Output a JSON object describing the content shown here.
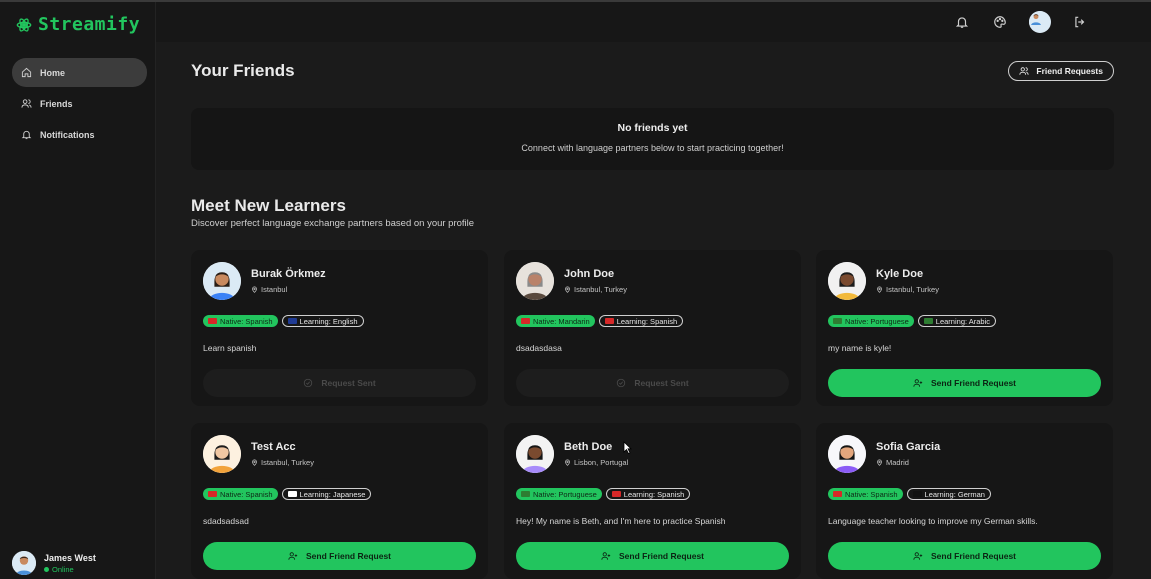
{
  "app": {
    "name": "Streamify"
  },
  "sidebar": {
    "items": [
      {
        "label": "Home",
        "icon": "home-icon",
        "active": true
      },
      {
        "label": "Friends",
        "icon": "users-icon",
        "active": false
      },
      {
        "label": "Notifications",
        "icon": "bell-icon",
        "active": false
      }
    ],
    "user": {
      "name": "James West",
      "status": "Online"
    }
  },
  "topbar": {
    "icons": [
      "bell-icon",
      "palette-icon",
      "avatar",
      "logout-icon"
    ]
  },
  "friends": {
    "title": "Your Friends",
    "requests_button": "Friend Requests",
    "empty_title": "No friends yet",
    "empty_subtitle": "Connect with language partners below to start practicing together!"
  },
  "learners": {
    "title": "Meet New Learners",
    "subtitle": "Discover perfect language exchange partners based on your profile",
    "cards": [
      {
        "name": "Burak Örkmez",
        "location": "Istanbul",
        "native": "Native: Spanish",
        "learning": "Learning: English",
        "bio": "Learn spanish",
        "button": "Request Sent",
        "sent": true
      },
      {
        "name": "John Doe",
        "location": "Istanbul, Turkey",
        "native": "Native: Mandarin",
        "learning": "Learning: Spanish",
        "bio": "dsadasdasa",
        "button": "Request Sent",
        "sent": true
      },
      {
        "name": "Kyle Doe",
        "location": "Istanbul, Turkey",
        "native": "Native: Portuguese",
        "learning": "Learning: Arabic",
        "bio": "my name is kyle!",
        "button": "Send Friend Request",
        "sent": false
      },
      {
        "name": "Test Acc",
        "location": "Istanbul, Turkey",
        "native": "Native: Spanish",
        "learning": "Learning: Japanese",
        "bio": "sdadsadsad",
        "button": "Send Friend Request",
        "sent": false
      },
      {
        "name": "Beth Doe",
        "location": "Lisbon, Portugal",
        "native": "Native: Portuguese",
        "learning": "Learning: Spanish",
        "bio": "Hey! My name is Beth, and I'm here to practice Spanish",
        "button": "Send Friend Request",
        "sent": false
      },
      {
        "name": "Sofia Garcia",
        "location": "Madrid",
        "native": "Native: Spanish",
        "learning": "Learning: German",
        "bio": "Language teacher looking to improve my German skills.",
        "button": "Send Friend Request",
        "sent": false
      }
    ]
  },
  "colors": {
    "accent": "#22c55e",
    "background": "#1b1b1b",
    "card": "#161616"
  }
}
